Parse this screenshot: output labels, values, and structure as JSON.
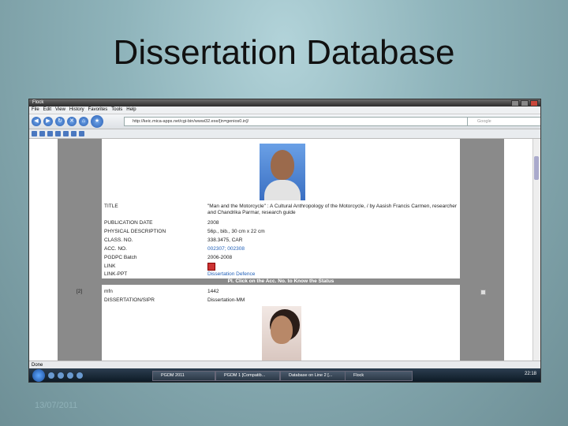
{
  "slide": {
    "title": "Dissertation Database",
    "date": "13/07/2011"
  },
  "window": {
    "title": "Flock"
  },
  "menu": [
    "File",
    "Edit",
    "View",
    "History",
    "Favorites",
    "Tools",
    "Help"
  ],
  "address": {
    "url": "http://keic.mica-apps.net/cgi-bin/wwwi32.exe/[in=genios0.in]/"
  },
  "search": {
    "placeholder": "Google"
  },
  "record1": {
    "rows": [
      {
        "label": "TITLE",
        "value": "\"Man and the Motorcycle\" : A Cultural Anthropology of the Motorcycle, / by Aasish Francis Carmen, researcher and Chandrika Parmar, research guide"
      },
      {
        "label": "PUBLICATION DATE",
        "value": "2008"
      },
      {
        "label": "PHYSICAL DESCRIPTION",
        "value": "56p., bib., 30 cm x 22 cm"
      },
      {
        "label": "CLASS. NO.",
        "value": "338.3475, CAR"
      },
      {
        "label": "ACC. NO.",
        "value": "002307; 002308"
      },
      {
        "label": "PGDPC Batch",
        "value": "2006-2008"
      },
      {
        "label": "LINK",
        "value": ""
      },
      {
        "label": "LINK-PPT",
        "value": "Dissertation Defence"
      }
    ]
  },
  "banner": "Pl. Click on the Acc. No. to Know the Status",
  "record2": {
    "index": "[2]",
    "rows": [
      {
        "label": "mfn",
        "value": "1442"
      },
      {
        "label": "DISSERTATION/SIPR",
        "value": "Dissertation-MM"
      }
    ]
  },
  "status": "Done",
  "taskbar": {
    "tasks": [
      "PGDM 2011",
      "PGDM 1 [Compatib...",
      "Database on Line 2 [...",
      "Flock"
    ],
    "clock": "22:18"
  }
}
